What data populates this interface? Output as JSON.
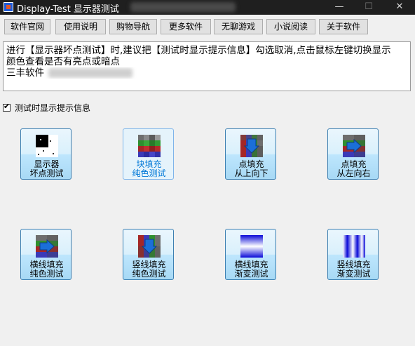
{
  "window": {
    "title": "Display-Test 显示器测试",
    "min_glyph": "—",
    "max_glyph": "☐",
    "close_glyph": "✕"
  },
  "menu": [
    "软件官网",
    "使用说明",
    "购物导航",
    "更多软件",
    "无聊游戏",
    "小说阅读",
    "关于软件"
  ],
  "info": {
    "line1": "进行【显示器坏点测试】时,建议把【测试时显示提示信息】勾选取消,点击鼠标左键切换显示",
    "line2": "颜色查看是否有亮点或暗点",
    "line3": "三丰软件"
  },
  "checkbox": {
    "label": "测试时显示提示信息",
    "checked": true
  },
  "tiles": [
    {
      "l1": "显示器",
      "l2": "坏点测试",
      "icon": "dead-pixel-icon"
    },
    {
      "l1": "块填充",
      "l2": "纯色测试",
      "icon": "block-fill-icon"
    },
    {
      "l1": "点填充",
      "l2": "从上向下",
      "icon": "point-fill-down-icon"
    },
    {
      "l1": "点填充",
      "l2": "从左向右",
      "icon": "point-fill-right-icon"
    },
    {
      "l1": "横线填充",
      "l2": "纯色测试",
      "icon": "hline-fill-icon"
    },
    {
      "l1": "竖线填充",
      "l2": "纯色测试",
      "icon": "vline-fill-icon"
    },
    {
      "l1": "横线填充",
      "l2": "渐变测试",
      "icon": "hgradient-icon"
    },
    {
      "l1": "竖线填充",
      "l2": "渐变测试",
      "icon": "vgradient-icon"
    }
  ],
  "colors": {
    "titlebar": "#1f1f1f",
    "tile_border": "#3c7fb1",
    "tile_selected_text": "#0078d7",
    "grid_rows": [
      "#a52727",
      "#2f8f2f",
      "#3a3ab8",
      "#6e6e6e"
    ]
  }
}
